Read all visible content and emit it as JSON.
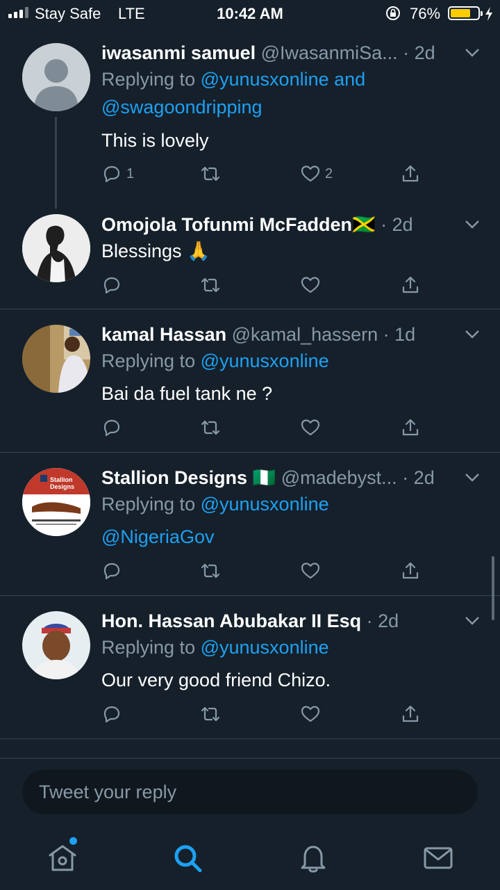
{
  "status_bar": {
    "carrier": "Stay Safe",
    "network": "LTE",
    "time": "10:42 AM",
    "battery_percent": "76%",
    "battery_level": 0.76
  },
  "tweets": [
    {
      "display_name": "iwasanmi samuel",
      "handle": "@IwasanmiSa...",
      "time": " · 2d",
      "replying_prefix": "Replying to ",
      "replying_to": "@yunusxonline and @swagoondripping",
      "text": "This is lovely",
      "reply_count": "1",
      "like_count": "2"
    },
    {
      "display_name": "Omojola Tofunmi McFadden",
      "flag": "🇯🇲",
      "time": " · 2d",
      "text": "Blessings 🙏"
    },
    {
      "display_name": "kamal Hassan",
      "handle": "@kamal_hassern",
      "time": " · 1d",
      "replying_prefix": "Replying to ",
      "replying_to": "@yunusxonline",
      "text": "Bai da fuel tank ne ?"
    },
    {
      "display_name": "Stallion Designs",
      "flag": "🇳🇬",
      "handle": "@madebyst...",
      "time": " · 2d",
      "replying_prefix": "Replying to ",
      "replying_to": "@yunusxonline",
      "text": "@NigeriaGov",
      "avatar_text": "Stallion Designs"
    },
    {
      "display_name": "Hon. Hassan Abubakar II Esq",
      "time": " · 2d",
      "replying_prefix": "Replying to ",
      "replying_to": "@yunusxonline",
      "text": "Our very good friend Chizo."
    }
  ],
  "reply_bar": {
    "placeholder": "Tweet your reply"
  },
  "tab_bar": {
    "items": [
      "home-icon",
      "search-icon",
      "notifications-icon",
      "messages-icon"
    ],
    "active": "search-icon"
  },
  "colors": {
    "background": "#15202b",
    "link": "#1da1f2",
    "secondary_text": "#8899a6",
    "divider": "#38444d"
  }
}
